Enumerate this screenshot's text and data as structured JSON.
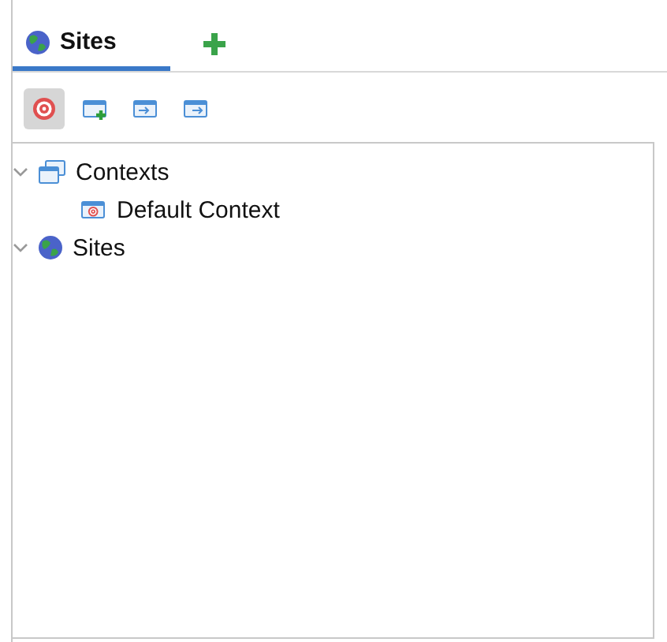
{
  "tabs": [
    {
      "label": "Sites",
      "selected": true
    }
  ],
  "toolbar": [
    {
      "kind": "target",
      "pressed": true
    },
    {
      "kind": "new-context",
      "pressed": false
    },
    {
      "kind": "import",
      "pressed": false
    },
    {
      "kind": "export",
      "pressed": false
    }
  ],
  "tree": [
    {
      "label": "Contexts",
      "kind": "contexts",
      "expanded": true,
      "children": [
        {
          "label": "Default Context",
          "kind": "context"
        }
      ]
    },
    {
      "label": "Sites",
      "kind": "sites",
      "expanded": true
    }
  ]
}
